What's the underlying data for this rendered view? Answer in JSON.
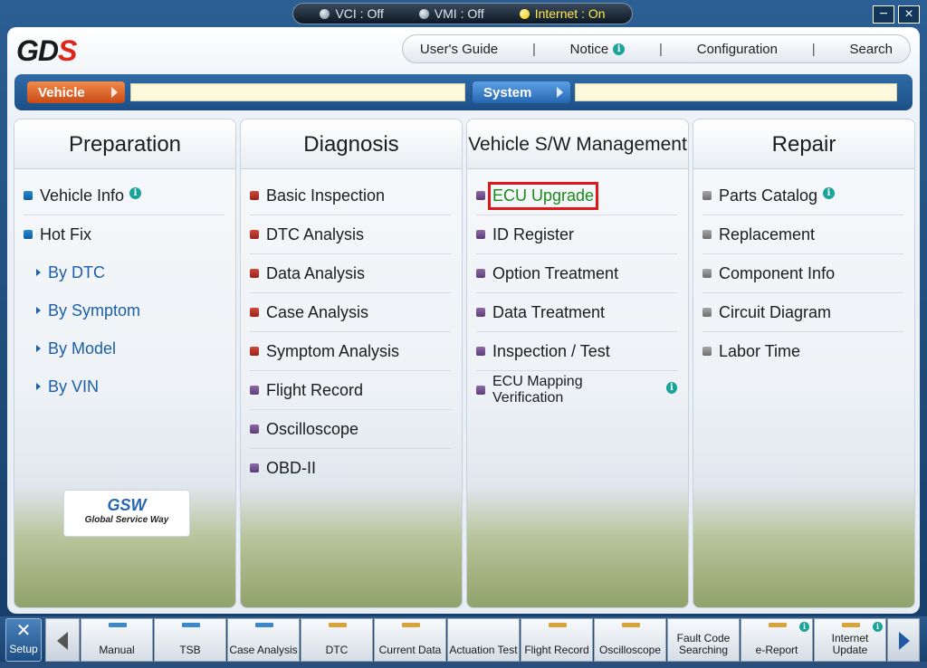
{
  "status": {
    "vci": "VCI : Off",
    "vmi": "VMI : Off",
    "internet": "Internet : On"
  },
  "window_controls": {
    "minimize": "−",
    "close": "×"
  },
  "logo": {
    "main": "GD",
    "accent": "S"
  },
  "topmenu": {
    "users_guide": "User's Guide",
    "notice": "Notice",
    "configuration": "Configuration",
    "search": "Search",
    "sep": "|"
  },
  "selector": {
    "vehicle": "Vehicle",
    "system": "System"
  },
  "columns": {
    "preparation": {
      "title": "Preparation",
      "items": [
        "Vehicle Info",
        "Hot Fix"
      ],
      "subitems": [
        "By DTC",
        "By Symptom",
        "By Model",
        "By VIN"
      ]
    },
    "diagnosis": {
      "title": "Diagnosis",
      "items": [
        "Basic Inspection",
        "DTC Analysis",
        "Data Analysis",
        "Case Analysis",
        "Symptom Analysis",
        "Flight Record",
        "Oscilloscope",
        "OBD-II"
      ]
    },
    "vsw": {
      "title": "Vehicle S/W Management",
      "items": [
        "ECU Upgrade",
        "ID Register",
        "Option Treatment",
        "Data Treatment",
        "Inspection / Test",
        "ECU Mapping Verification"
      ]
    },
    "repair": {
      "title": "Repair",
      "items": [
        "Parts Catalog",
        "Replacement",
        "Component Info",
        "Circuit Diagram",
        "Labor Time"
      ]
    }
  },
  "gsw": {
    "logo": "GSW",
    "tagline": "Global Service Way"
  },
  "info_glyph": "i",
  "toolbar": {
    "setup": "Setup",
    "buttons": [
      "Manual",
      "TSB",
      "Case Analysis",
      "DTC",
      "Current Data",
      "Actuation Test",
      "Flight Record",
      "Oscilloscope",
      "Fault Code Searching",
      "e-Report",
      "Internet Update"
    ]
  },
  "colors": {
    "accent_blue": "#1c4f86",
    "highlight_red": "#e01818",
    "selected_green": "#1a8a1a"
  }
}
